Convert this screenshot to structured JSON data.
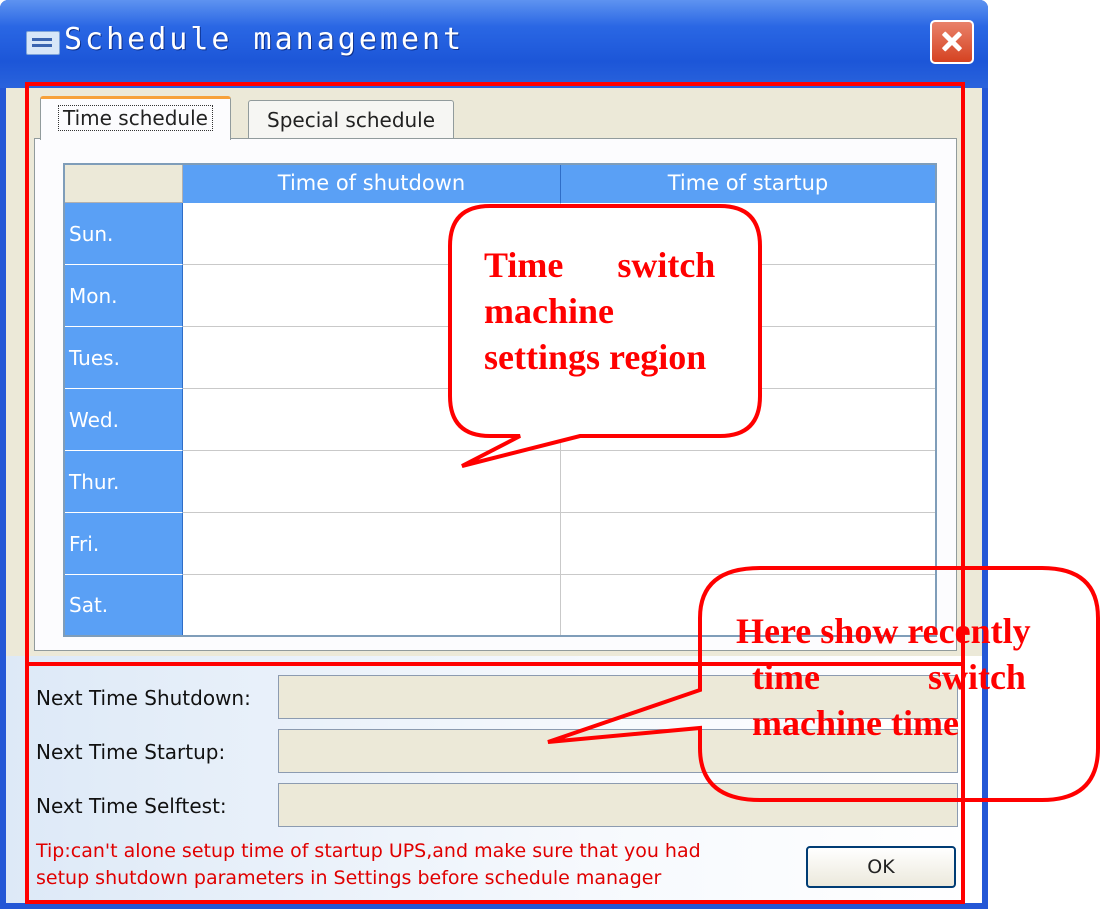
{
  "window": {
    "title": "Schedule management",
    "icons": {
      "app": "window-app-icon",
      "close": "close-icon"
    }
  },
  "tabs": [
    {
      "label": "Time schedule",
      "active": true
    },
    {
      "label": "Special schedule",
      "active": false
    }
  ],
  "schedule_table": {
    "columns": [
      "Time of shutdown",
      "Time of startup"
    ],
    "rows": [
      {
        "day": "Sun.",
        "shutdown": "",
        "startup": ""
      },
      {
        "day": "Mon.",
        "shutdown": "",
        "startup": ""
      },
      {
        "day": "Tues.",
        "shutdown": "",
        "startup": ""
      },
      {
        "day": "Wed.",
        "shutdown": "",
        "startup": ""
      },
      {
        "day": "Thur.",
        "shutdown": "",
        "startup": ""
      },
      {
        "day": "Fri.",
        "shutdown": "",
        "startup": ""
      },
      {
        "day": "Sat.",
        "shutdown": "",
        "startup": ""
      }
    ]
  },
  "next_times": {
    "shutdown_label": "Next Time Shutdown:",
    "shutdown_value": "",
    "startup_label": "Next Time Startup:",
    "startup_value": "",
    "selftest_label": "Next Time Selftest:",
    "selftest_value": ""
  },
  "tip": {
    "line1": "Tip:can't alone setup time of startup UPS,and make sure that you had",
    "line2": "setup shutdown parameters in Settings before schedule manager"
  },
  "buttons": {
    "ok": "OK"
  },
  "annotations": {
    "settings_region": [
      "Time      switch",
      "machine",
      "settings region"
    ],
    "recent_times": [
      "Here show recently",
      "time            switch",
      "machine time"
    ]
  },
  "colors": {
    "title_bar": "#2a67e4",
    "header_blue": "#5aa0f5",
    "annotation_red": "#ff0000",
    "tab_highlight": "#f7a13a"
  }
}
